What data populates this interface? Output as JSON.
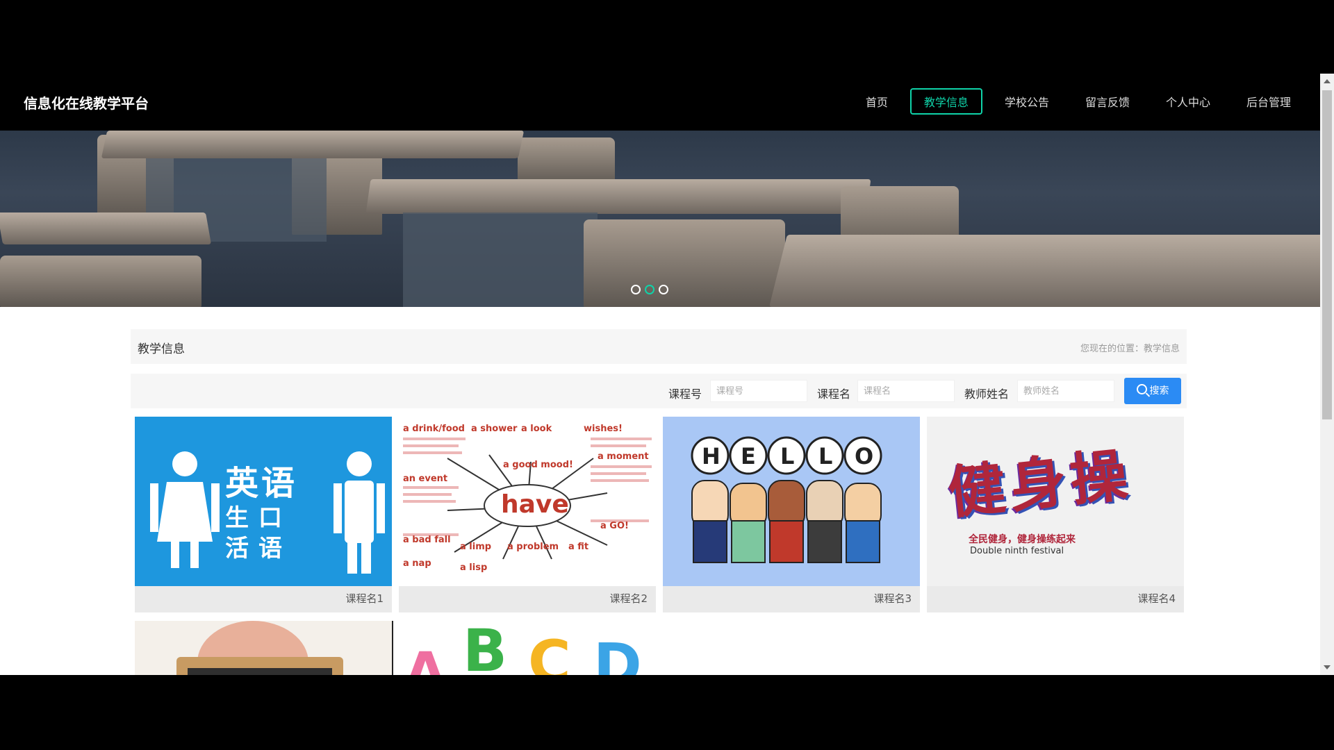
{
  "header": {
    "site_title": "信息化在线教学平台",
    "nav": [
      {
        "label": "首页",
        "active": false
      },
      {
        "label": "教学信息",
        "active": true
      },
      {
        "label": "学校公告",
        "active": false
      },
      {
        "label": "留言反馈",
        "active": false
      },
      {
        "label": "个人中心",
        "active": false
      },
      {
        "label": "后台管理",
        "active": false
      }
    ]
  },
  "carousel": {
    "slides": 3,
    "active_index": 1
  },
  "section": {
    "title": "教学信息",
    "location": "您现在的位置：教学信息"
  },
  "search": {
    "course_no_label": "课程号",
    "course_no_placeholder": "课程号",
    "course_name_label": "课程名",
    "course_name_placeholder": "课程名",
    "teacher_label": "教师姓名",
    "teacher_placeholder": "教师姓名",
    "button_label": "搜索"
  },
  "cards": [
    {
      "label": "课程名1",
      "image_text": [
        "英语",
        "生口",
        "活语"
      ]
    },
    {
      "label": "课程名2",
      "image_text": [
        "have",
        "a drink/food",
        "a shower",
        "a look",
        "wishes!",
        "a good mood!",
        "an event",
        "a moment",
        "a bad fall",
        "a limp",
        "a problem",
        "a fit",
        "a nap",
        "a lisp",
        "a GO!"
      ]
    },
    {
      "label": "课程名3",
      "image_text": [
        "H",
        "E",
        "L",
        "L",
        "O"
      ]
    },
    {
      "label": "课程名4",
      "image_text": [
        "健身操",
        "全民健身，健身操练起来",
        "Double ninth festival"
      ]
    }
  ],
  "partial_row": {
    "letters": [
      "A",
      "B",
      "C",
      "D"
    ]
  }
}
